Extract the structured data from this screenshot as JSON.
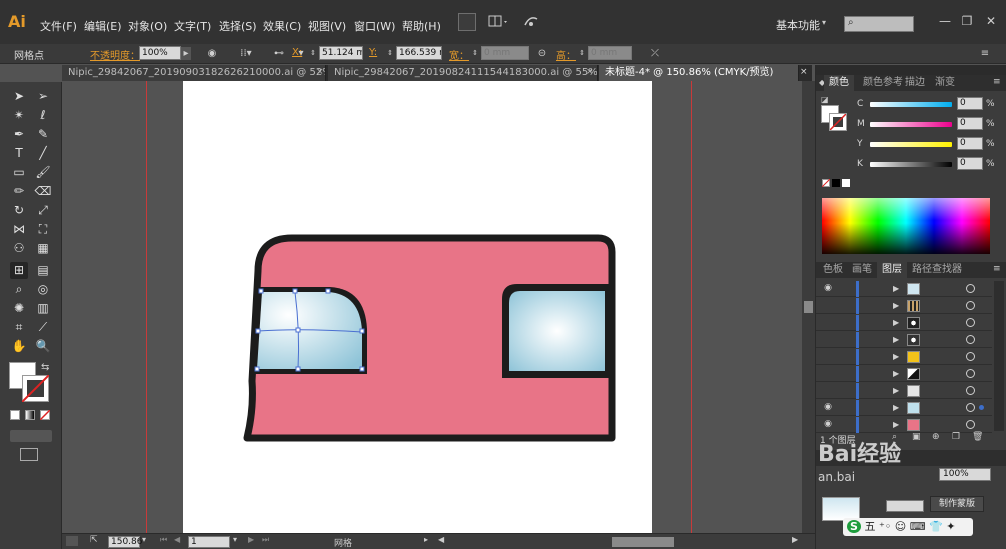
{
  "app": {
    "logo": "Ai"
  },
  "menu": [
    "文件(F)",
    "编辑(E)",
    "对象(O)",
    "文字(T)",
    "选择(S)",
    "效果(C)",
    "视图(V)",
    "窗口(W)",
    "帮助(H)"
  ],
  "workspace": "基本功能",
  "control_bar": {
    "object_label": "网格点",
    "opacity_label": "不透明度：",
    "opacity_value": "100%",
    "x_label": "X:",
    "x_value": "51.124 mm",
    "y_label": "Y:",
    "y_value": "166.539 m",
    "w_label": "宽：",
    "w_value": "0 mm",
    "h_label": "高：",
    "h_value": "0 mm"
  },
  "tabs": [
    {
      "label": "Nipic_29842067_20190903182626210000.ai @ 52%...",
      "active": false
    },
    {
      "label": "Nipic_29842067_20190824111544183000.ai @ 55%...",
      "active": false
    },
    {
      "label": "未标题-4* @ 150.86% (CMYK/预览)",
      "active": true
    }
  ],
  "status_bar": {
    "zoom": "150.86",
    "page": "1",
    "tool_name": "网格"
  },
  "color_panel": {
    "tabs": [
      "颜色",
      "颜色参考",
      "描边",
      "渐变"
    ],
    "sliders": [
      {
        "label": "C",
        "value": "0",
        "unit": "%",
        "gradient": "#ffffff,#00aeef"
      },
      {
        "label": "M",
        "value": "0",
        "unit": "%",
        "gradient": "#ffffff,#ec008c"
      },
      {
        "label": "Y",
        "value": "0",
        "unit": "%",
        "gradient": "#ffffff,#fff200"
      },
      {
        "label": "K",
        "value": "0",
        "unit": "%",
        "gradient": "#ffffff,#000000"
      }
    ]
  },
  "layers_panel": {
    "tabs": [
      "色板",
      "画笔",
      "图层",
      "路径查找器"
    ],
    "footer": "1 个图层",
    "rows": [
      {
        "eye": true,
        "thumb": "#cfe6f0"
      },
      {
        "eye": false,
        "thumb": "#c8a26a"
      },
      {
        "eye": false,
        "thumb": "#222222"
      },
      {
        "eye": false,
        "thumb": "#333333"
      },
      {
        "eye": false,
        "thumb": "#f2c21b"
      },
      {
        "eye": false,
        "thumb": "#111111"
      },
      {
        "eye": false,
        "thumb": "#e6e6e6"
      },
      {
        "eye": true,
        "thumb": "#bfe0ec"
      },
      {
        "eye": true,
        "thumb": "#e87487"
      }
    ]
  },
  "transparency_panel": {
    "opacity": "100%",
    "make_mask_button": "制作蒙版"
  },
  "illustration": {
    "body_fill": "#e87487",
    "stroke": "#1c1c1c",
    "window_light": "#ffffff",
    "window_dark": "#8fc4d8"
  },
  "overlay": {
    "watermark": "Bai经验",
    "watermark_sub": "an.bai",
    "ime": "五"
  }
}
